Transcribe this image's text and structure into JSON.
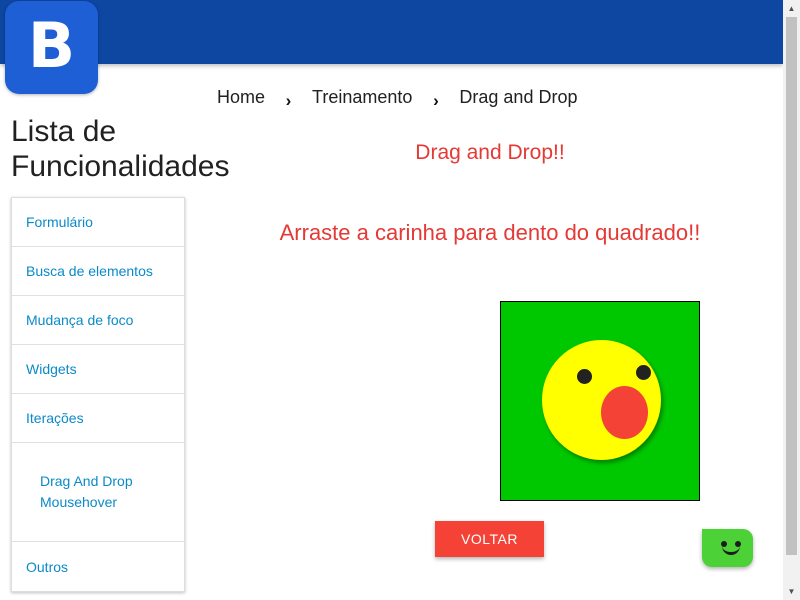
{
  "header": {
    "logo_letter": "B",
    "bar_color": "#0d47a1"
  },
  "breadcrumb": {
    "items": [
      "Home",
      "Treinamento",
      "Drag and Drop"
    ],
    "separator": "›"
  },
  "sidebar": {
    "title": "Lista de Funcionalidades",
    "items": [
      {
        "label": "Formulário"
      },
      {
        "label": "Busca de elementos"
      },
      {
        "label": "Mudança de foco"
      },
      {
        "label": "Widgets"
      },
      {
        "label": "Iterações"
      }
    ],
    "subitems": [
      {
        "label": "Drag And Drop"
      },
      {
        "label": "Mousehover"
      }
    ],
    "last_item": {
      "label": "Outros"
    }
  },
  "main": {
    "heading": "Drag and Drop!!",
    "instruction": "Arraste a carinha para dento do quadrado!!",
    "drop_box_color": "#00c800",
    "smiley_color": "#ffff00",
    "back_button": "VOLTAR"
  },
  "colors": {
    "accent_red": "#e53935",
    "link_blue": "#0a8ac9",
    "chat_green": "#4cd137"
  },
  "icons": {
    "logo": "b-logo-icon",
    "breadcrumb_separator": "chevron-right-icon",
    "chat": "chat-bot-icon"
  }
}
